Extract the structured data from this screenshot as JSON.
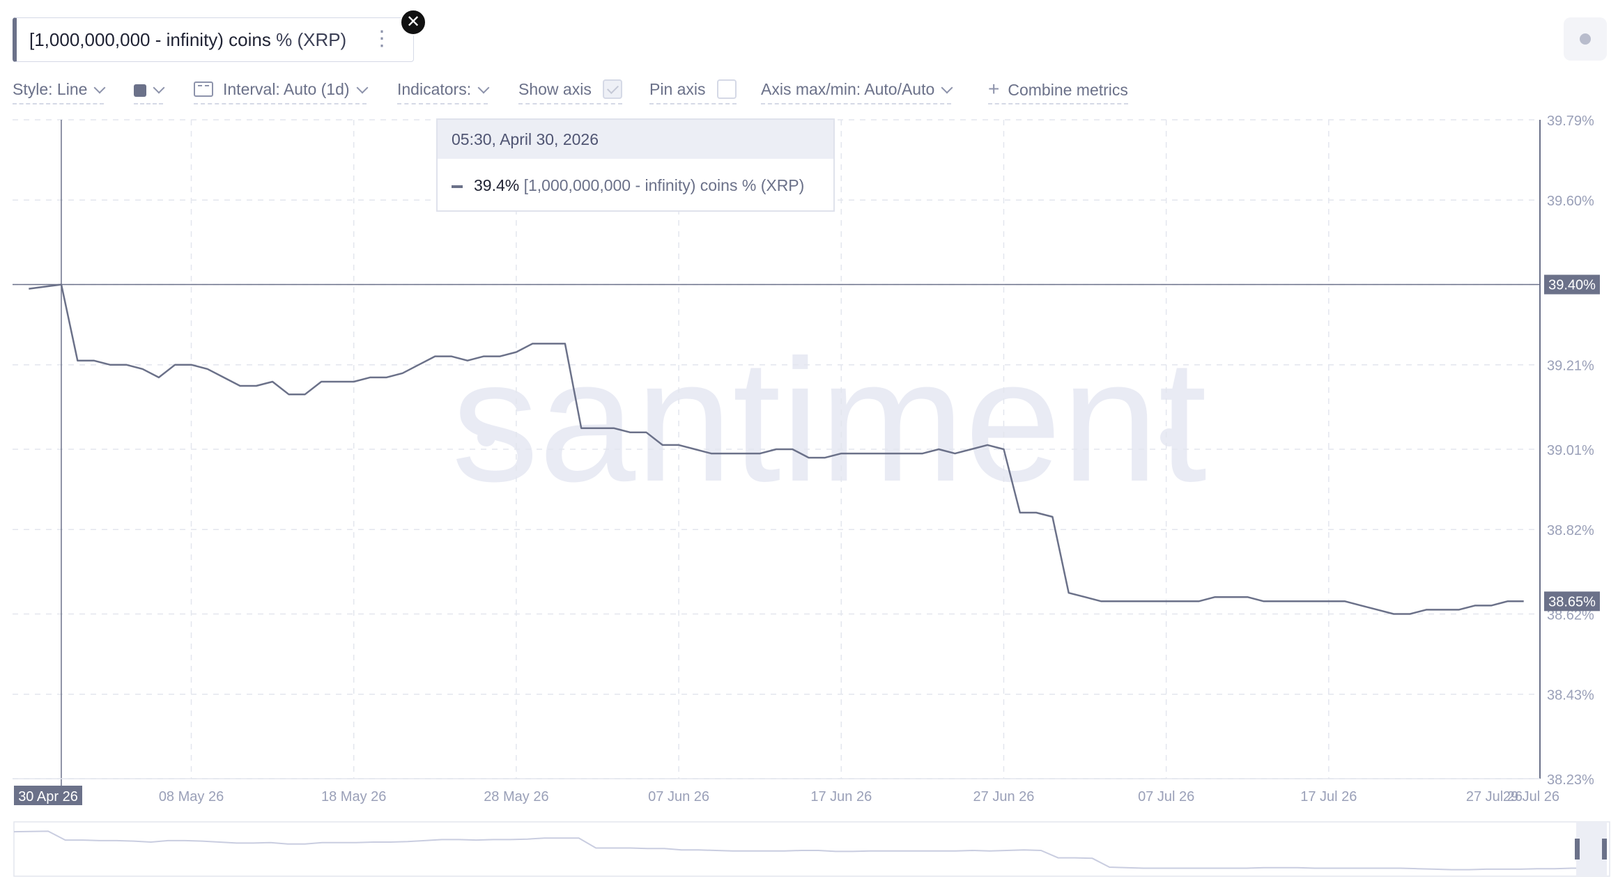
{
  "metric": {
    "label_main": "[1,000,000,000 - infinity) coins",
    "label_suffix": " % (XRP)",
    "menu_icon": "kebab-icon",
    "close_icon": "close-icon"
  },
  "toolbar": {
    "style_label": "Style: Line",
    "interval_label": "Interval: Auto (1d)",
    "indicators_label": "Indicators:",
    "show_axis_label": "Show axis",
    "show_axis_checked": true,
    "pin_axis_label": "Pin axis",
    "pin_axis_checked": false,
    "axis_maxmin_label": "Axis max/min: Auto/Auto",
    "combine_label": "Combine metrics"
  },
  "tooltip": {
    "date": "05:30, April 30, 2026",
    "value": "39.4%",
    "series": "[1,000,000,000 - infinity) coins % (XRP)"
  },
  "watermark": "santiment",
  "colors": {
    "line": "#6b7189",
    "accent_badge": "#6b7189",
    "grid": "#e3e6ee",
    "navigator": "#c9cde0"
  },
  "chart_data": {
    "type": "line",
    "x_start": "2026-04-27",
    "x_end": "2026-07-30",
    "xticks": [
      {
        "date": "2026-04-30",
        "label": "30 Apr 26",
        "highlight": true
      },
      {
        "date": "2026-05-08",
        "label": "08 May 26"
      },
      {
        "date": "2026-05-18",
        "label": "18 May 26"
      },
      {
        "date": "2026-05-28",
        "label": "28 May 26"
      },
      {
        "date": "2026-06-07",
        "label": "07 Jun 26"
      },
      {
        "date": "2026-06-17",
        "label": "17 Jun 26"
      },
      {
        "date": "2026-06-27",
        "label": "27 Jun 26"
      },
      {
        "date": "2026-07-07",
        "label": "07 Jul 26"
      },
      {
        "date": "2026-07-17",
        "label": "17 Jul 26"
      },
      {
        "date": "2026-07-27",
        "label": "27 Jul 26"
      },
      {
        "date": "2026-07-29",
        "label": "29 Jul 26"
      }
    ],
    "ylim": [
      38.23,
      39.79
    ],
    "yticks": [
      "39.79%",
      "39.60%",
      "39.40%",
      "39.21%",
      "39.01%",
      "38.82%",
      "38.62%",
      "38.43%",
      "38.23%"
    ],
    "ytick_values": [
      39.79,
      39.6,
      39.4,
      39.21,
      39.01,
      38.82,
      38.62,
      38.43,
      38.23
    ],
    "crosshair": {
      "date": "2026-04-30",
      "value": 39.4,
      "label": "39.40%"
    },
    "last_value": {
      "value": 38.65,
      "label": "38.65%"
    },
    "series": [
      {
        "name": "[1,000,000,000 - infinity) coins % (XRP)",
        "points": [
          [
            "2026-04-28",
            39.39
          ],
          [
            "2026-04-30",
            39.4
          ],
          [
            "2026-05-01",
            39.22
          ],
          [
            "2026-05-02",
            39.22
          ],
          [
            "2026-05-03",
            39.21
          ],
          [
            "2026-05-04",
            39.21
          ],
          [
            "2026-05-05",
            39.2
          ],
          [
            "2026-05-06",
            39.18
          ],
          [
            "2026-05-07",
            39.21
          ],
          [
            "2026-05-08",
            39.21
          ],
          [
            "2026-05-09",
            39.2
          ],
          [
            "2026-05-10",
            39.18
          ],
          [
            "2026-05-11",
            39.16
          ],
          [
            "2026-05-12",
            39.16
          ],
          [
            "2026-05-13",
            39.17
          ],
          [
            "2026-05-14",
            39.14
          ],
          [
            "2026-05-15",
            39.14
          ],
          [
            "2026-05-16",
            39.17
          ],
          [
            "2026-05-17",
            39.17
          ],
          [
            "2026-05-18",
            39.17
          ],
          [
            "2026-05-19",
            39.18
          ],
          [
            "2026-05-20",
            39.18
          ],
          [
            "2026-05-21",
            39.19
          ],
          [
            "2026-05-22",
            39.21
          ],
          [
            "2026-05-23",
            39.23
          ],
          [
            "2026-05-24",
            39.23
          ],
          [
            "2026-05-25",
            39.22
          ],
          [
            "2026-05-26",
            39.23
          ],
          [
            "2026-05-27",
            39.23
          ],
          [
            "2026-05-28",
            39.24
          ],
          [
            "2026-05-29",
            39.26
          ],
          [
            "2026-05-30",
            39.26
          ],
          [
            "2026-05-31",
            39.26
          ],
          [
            "2026-06-01",
            39.06
          ],
          [
            "2026-06-02",
            39.06
          ],
          [
            "2026-06-03",
            39.06
          ],
          [
            "2026-06-04",
            39.05
          ],
          [
            "2026-06-05",
            39.05
          ],
          [
            "2026-06-06",
            39.02
          ],
          [
            "2026-06-07",
            39.02
          ],
          [
            "2026-06-08",
            39.01
          ],
          [
            "2026-06-09",
            39.0
          ],
          [
            "2026-06-10",
            39.0
          ],
          [
            "2026-06-11",
            39.0
          ],
          [
            "2026-06-12",
            39.0
          ],
          [
            "2026-06-13",
            39.01
          ],
          [
            "2026-06-14",
            39.01
          ],
          [
            "2026-06-15",
            38.99
          ],
          [
            "2026-06-16",
            38.99
          ],
          [
            "2026-06-17",
            39.0
          ],
          [
            "2026-06-18",
            39.0
          ],
          [
            "2026-06-19",
            39.0
          ],
          [
            "2026-06-20",
            39.0
          ],
          [
            "2026-06-21",
            39.0
          ],
          [
            "2026-06-22",
            39.0
          ],
          [
            "2026-06-23",
            39.01
          ],
          [
            "2026-06-24",
            39.0
          ],
          [
            "2026-06-25",
            39.01
          ],
          [
            "2026-06-26",
            39.02
          ],
          [
            "2026-06-27",
            39.01
          ],
          [
            "2026-06-28",
            38.86
          ],
          [
            "2026-06-29",
            38.86
          ],
          [
            "2026-06-30",
            38.85
          ],
          [
            "2026-07-01",
            38.67
          ],
          [
            "2026-07-02",
            38.66
          ],
          [
            "2026-07-03",
            38.65
          ],
          [
            "2026-07-04",
            38.65
          ],
          [
            "2026-07-05",
            38.65
          ],
          [
            "2026-07-06",
            38.65
          ],
          [
            "2026-07-07",
            38.65
          ],
          [
            "2026-07-08",
            38.65
          ],
          [
            "2026-07-09",
            38.65
          ],
          [
            "2026-07-10",
            38.66
          ],
          [
            "2026-07-11",
            38.66
          ],
          [
            "2026-07-12",
            38.66
          ],
          [
            "2026-07-13",
            38.65
          ],
          [
            "2026-07-14",
            38.65
          ],
          [
            "2026-07-15",
            38.65
          ],
          [
            "2026-07-16",
            38.65
          ],
          [
            "2026-07-17",
            38.65
          ],
          [
            "2026-07-18",
            38.65
          ],
          [
            "2026-07-19",
            38.64
          ],
          [
            "2026-07-20",
            38.63
          ],
          [
            "2026-07-21",
            38.62
          ],
          [
            "2026-07-22",
            38.62
          ],
          [
            "2026-07-23",
            38.63
          ],
          [
            "2026-07-24",
            38.63
          ],
          [
            "2026-07-25",
            38.63
          ],
          [
            "2026-07-26",
            38.64
          ],
          [
            "2026-07-27",
            38.64
          ],
          [
            "2026-07-28",
            38.65
          ],
          [
            "2026-07-29",
            38.65
          ]
        ]
      }
    ]
  }
}
